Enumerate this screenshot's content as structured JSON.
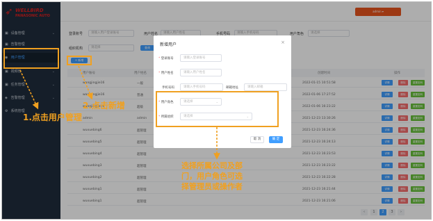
{
  "logo": {
    "top": "WELLBIRD",
    "bottom": "PANASONIC AUTO"
  },
  "header": {
    "user_label": "admin ▾"
  },
  "sidebar": {
    "items": [
      {
        "label": "设备管理",
        "icon": "device-icon"
      },
      {
        "label": "告警管理",
        "icon": "alarm-icon"
      },
      {
        "label": "用户管理",
        "icon": "user-icon"
      },
      {
        "label": "视频管",
        "icon": "video-icon"
      },
      {
        "label": "任务管理",
        "icon": "task-icon"
      },
      {
        "label": "告警管理",
        "icon": "bell-icon"
      },
      {
        "label": "系统管理",
        "icon": "gear-icon"
      }
    ]
  },
  "filters": {
    "account_label": "登录账号",
    "account_placeholder": "请输入用户登录账号",
    "username_label": "用户姓名",
    "username_placeholder": "请输入用户姓名",
    "phone_label": "手机号码",
    "phone_placeholder": "请输入手机号码",
    "role_label": "用户角色",
    "role_placeholder": "请选择",
    "org_label": "组织机构",
    "org_placeholder": "请选择",
    "query_label": "查询",
    "add_label": "+ 新增"
  },
  "table": {
    "headers": [
      "用户账号",
      "用户姓名",
      "用户角色",
      "组织机构",
      "手机号码",
      "创建时间",
      "操作"
    ],
    "rows": [
      {
        "account": "wangjingjie16",
        "role": "一般",
        "created": "2022-01-15 10:51:58"
      },
      {
        "account": "wangjingjie16",
        "role": "普通",
        "created": "2022-01-06 17:27:52"
      },
      {
        "account": "wangjingjie16",
        "role": "超级",
        "created": "2022-01-06 16:23:22"
      },
      {
        "account": "admin",
        "role": "admin",
        "created": "2021-12-23 13:30:26"
      },
      {
        "account": "wuxuebing6",
        "role": "超管理",
        "created": "2021-12-23 16:24:36"
      },
      {
        "account": "wuxuebing5",
        "role": "超管理",
        "created": "2021-12-23 16:24:13"
      },
      {
        "account": "wuxuebing4",
        "role": "超管理",
        "created": "2021-12-23 16:23:53"
      },
      {
        "account": "wuxuebing3",
        "role": "超管理",
        "created": "2021-12-23 16:23:22"
      },
      {
        "account": "wuxuebing2",
        "role": "超管理",
        "created": "2021-12-23 16:22:28"
      },
      {
        "account": "wuxuebing1",
        "role": "超管理",
        "created": "2021-12-23 16:21:44"
      },
      {
        "account": "wuxuebing1",
        "role": "超管理",
        "created": "2021-12-23 16:21:06"
      }
    ],
    "actions": {
      "edit": "详情",
      "delete": "删除",
      "reset": "重置密码"
    }
  },
  "pagination": {
    "pages": [
      "1",
      "2",
      "3"
    ],
    "current": "2"
  },
  "dialog": {
    "title": "新增用户",
    "close": "×",
    "account_label": "登录账号",
    "account_placeholder": "请输入登录账号",
    "name_label": "用户姓名",
    "name_placeholder": "请输入用户姓名",
    "phone_label": "手机号码",
    "phone_placeholder": "请输入手机号码",
    "email_label": "邮箱地址",
    "email_placeholder": "请输入邮箱",
    "role_label": "用户角色",
    "role_placeholder": "请选择",
    "org_label": "所属组织",
    "org_placeholder": "请选择",
    "cancel_label": "取 消",
    "confirm_label": "确 定"
  },
  "annotations": {
    "step1": "1.点击用户管理",
    "step2": "2.点击新增",
    "step3_line1": "选择所属公司及部",
    "step3_line2": "门，用户角色可选",
    "step3_line3": "择管理员或操作者"
  },
  "colors": {
    "sidebar": "#1f2d3d",
    "accent": "#409eff",
    "annotation": "#f0a020",
    "danger": "#f56c6c",
    "success": "#67c23a"
  }
}
